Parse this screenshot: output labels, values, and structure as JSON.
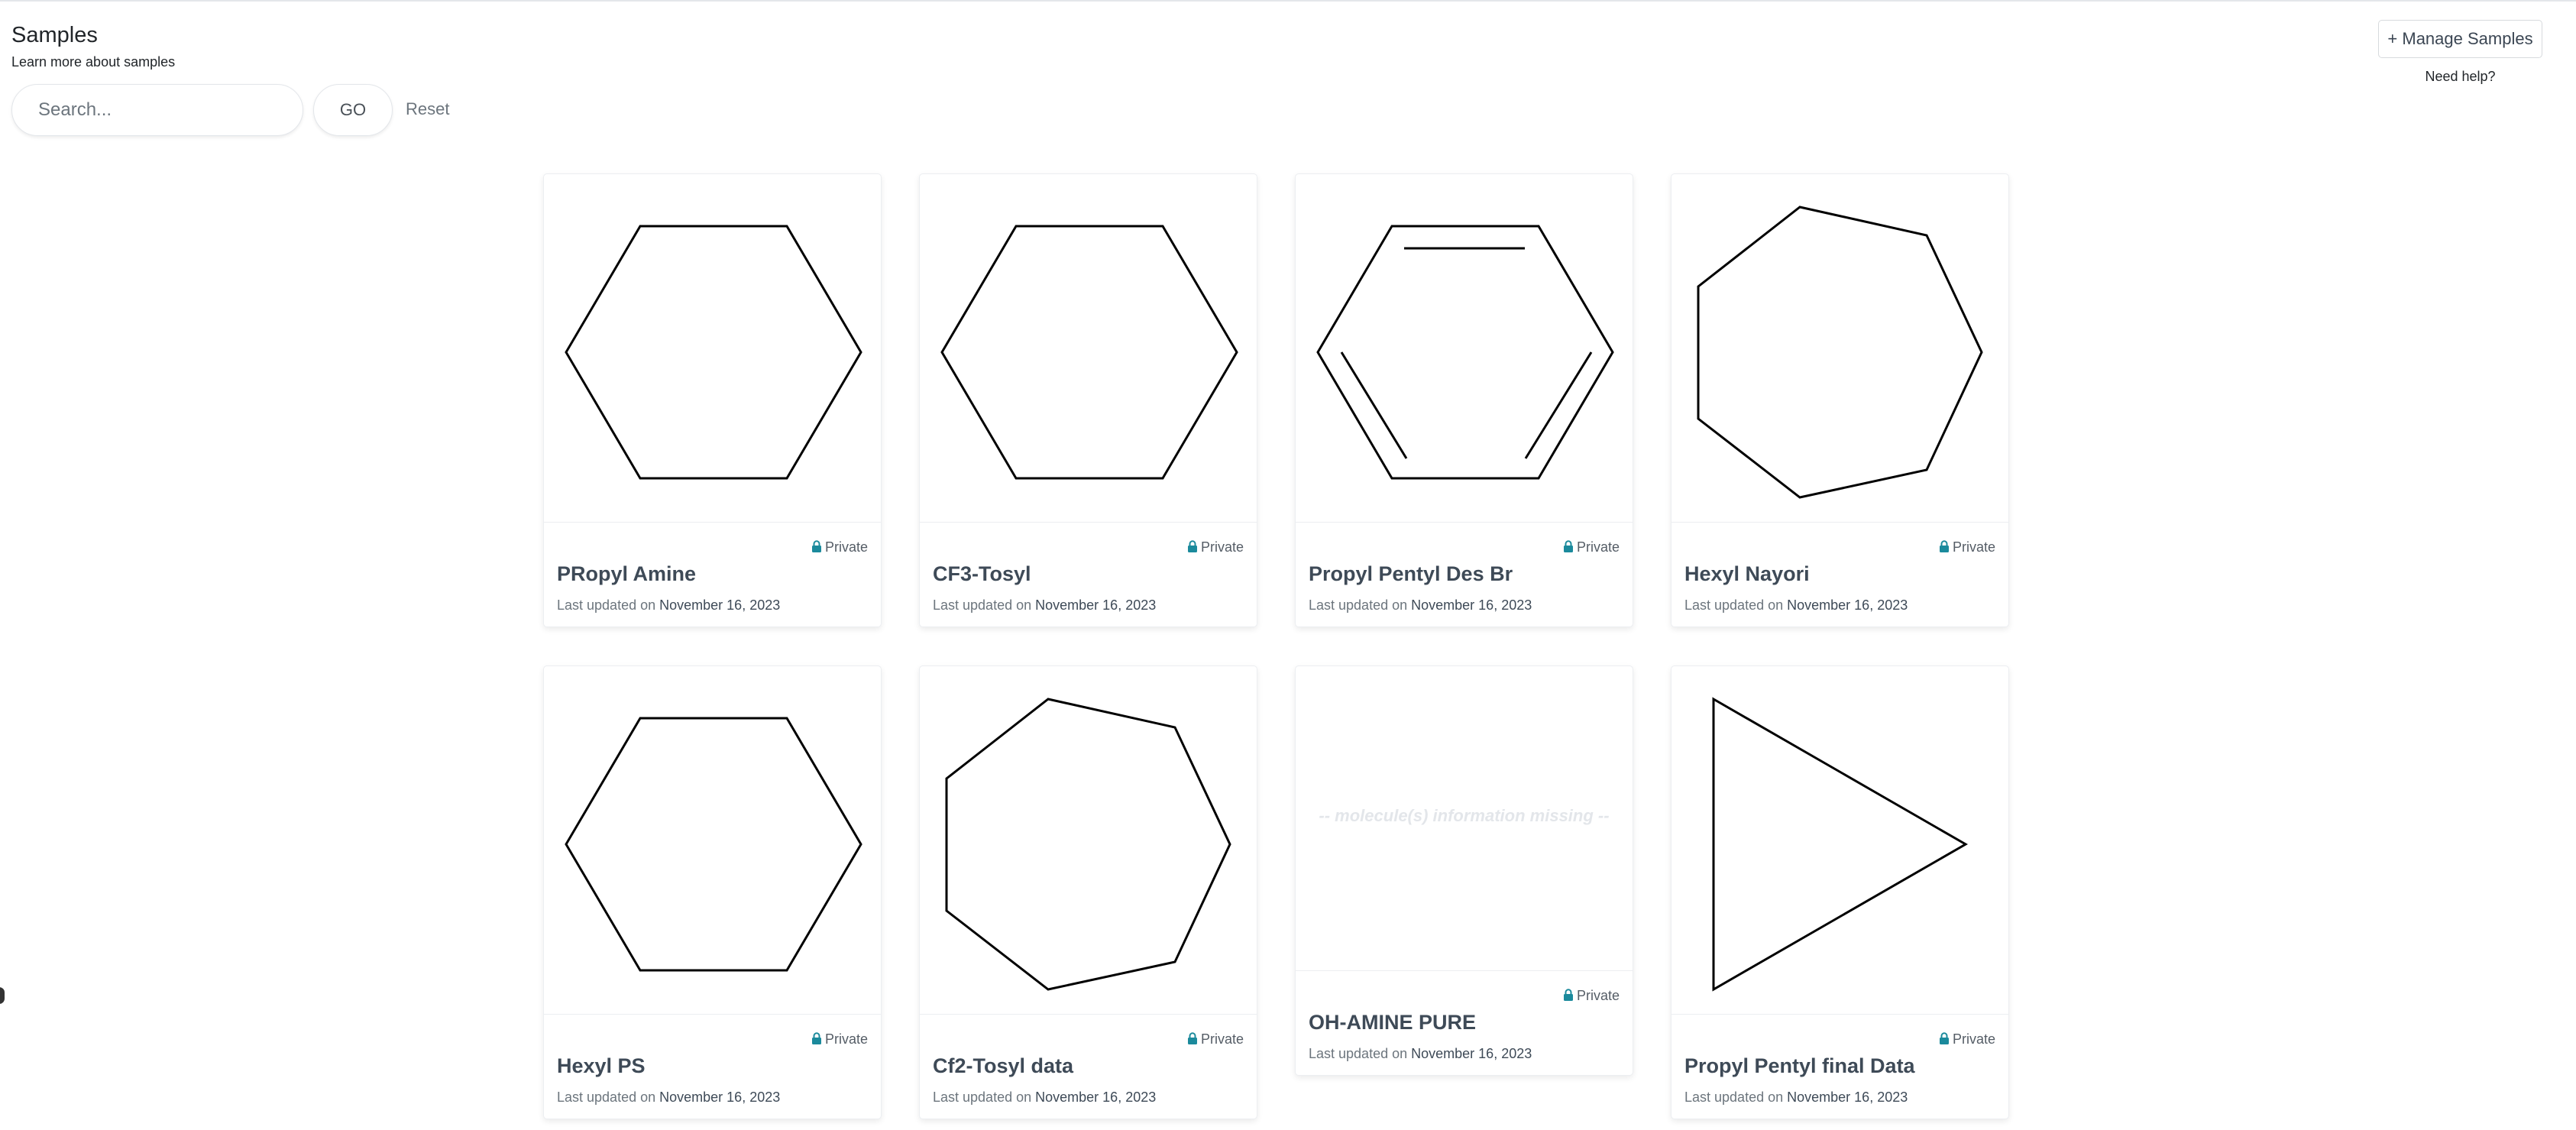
{
  "header": {
    "title": "Samples",
    "learn_more": "Learn more about samples",
    "manage_label": "+ Manage Samples",
    "help_label": "Need help?"
  },
  "search": {
    "placeholder": "Search...",
    "value": "",
    "go_label": "GO",
    "reset_label": "Reset"
  },
  "colors": {
    "lock_accent": "#1b8a9c",
    "title_text": "#3e4a57"
  },
  "samples": [
    {
      "name": "PRopyl Amine",
      "privacy": "Private",
      "updated_prefix": "Last updated on",
      "updated_date": "November 16, 2023",
      "structure": "hexagon"
    },
    {
      "name": "CF3-Tosyl",
      "privacy": "Private",
      "updated_prefix": "Last updated on",
      "updated_date": "November 16, 2023",
      "structure": "hexagon"
    },
    {
      "name": "Propyl Pentyl Des Br",
      "privacy": "Private",
      "updated_prefix": "Last updated on",
      "updated_date": "November 16, 2023",
      "structure": "benzene"
    },
    {
      "name": "Hexyl Nayori",
      "privacy": "Private",
      "updated_prefix": "Last updated on",
      "updated_date": "November 16, 2023",
      "structure": "heptagon"
    },
    {
      "name": "Hexyl PS",
      "privacy": "Private",
      "updated_prefix": "Last updated on",
      "updated_date": "November 16, 2023",
      "structure": "hexagon"
    },
    {
      "name": "Cf2-Tosyl data",
      "privacy": "Private",
      "updated_prefix": "Last updated on",
      "updated_date": "November 16, 2023",
      "structure": "heptagon"
    },
    {
      "name": "OH-AMINE PURE",
      "privacy": "Private",
      "updated_prefix": "Last updated on",
      "updated_date": "November 16, 2023",
      "structure": "missing",
      "missing_text": "-- molecule(s) information missing --"
    },
    {
      "name": "Propyl Pentyl final Data",
      "privacy": "Private",
      "updated_prefix": "Last updated on",
      "updated_date": "November 16, 2023",
      "structure": "triangle"
    }
  ]
}
